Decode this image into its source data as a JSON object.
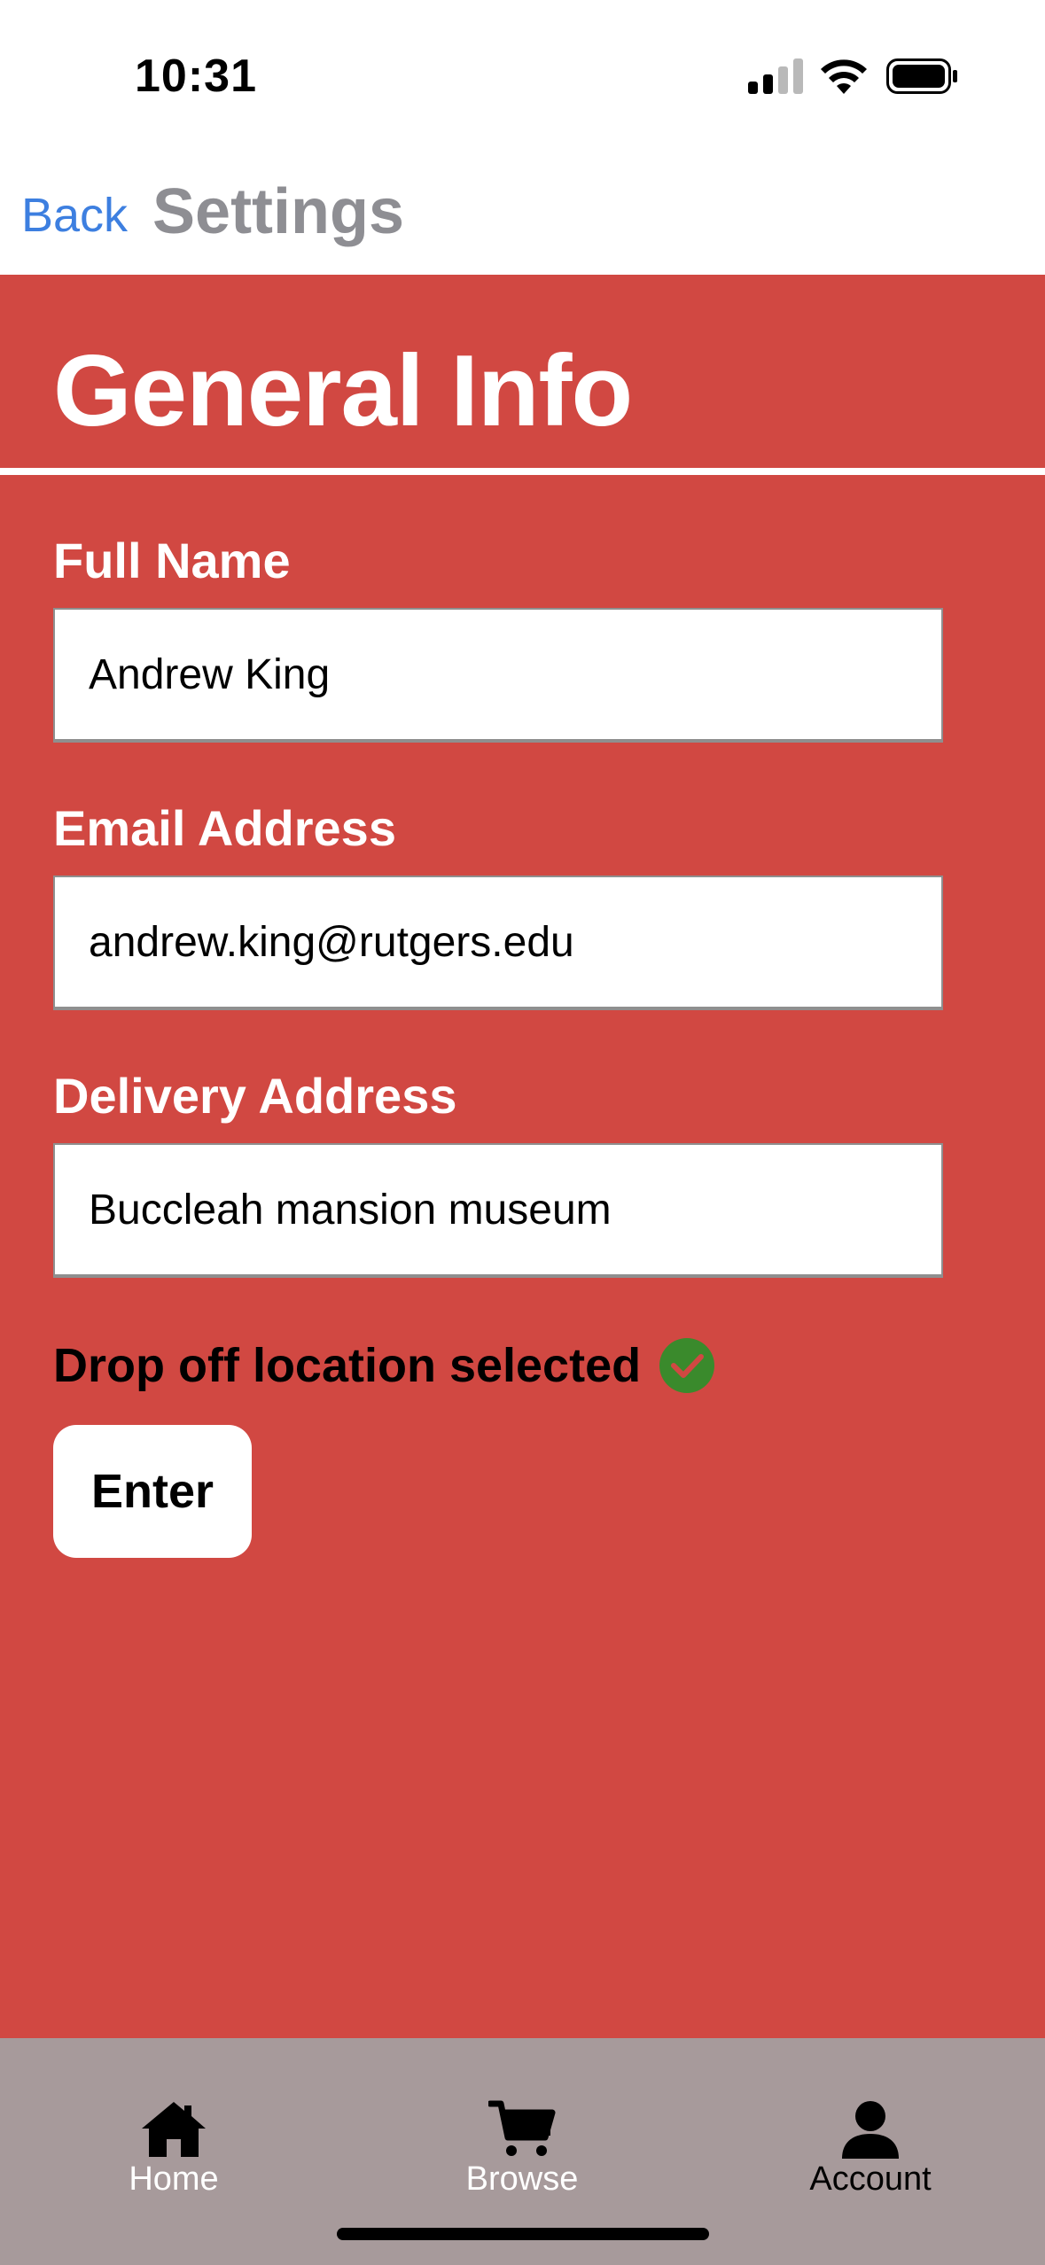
{
  "status_bar": {
    "time": "10:31"
  },
  "nav": {
    "back_label": "Back",
    "title": "Settings"
  },
  "page": {
    "title": "General Info"
  },
  "form": {
    "full_name": {
      "label": "Full Name",
      "value": "Andrew King"
    },
    "email": {
      "label": "Email Address",
      "value": "andrew.king@rutgers.edu"
    },
    "delivery": {
      "label": "Delivery Address",
      "value": "Buccleah mansion museum"
    },
    "status_text": "Drop off location selected",
    "enter_label": "Enter"
  },
  "tabs": [
    {
      "label": "Home",
      "icon": "home-icon"
    },
    {
      "label": "Browse",
      "icon": "cart-icon"
    },
    {
      "label": "Account",
      "icon": "person-icon"
    }
  ],
  "colors": {
    "main_bg": "#d14842",
    "tab_bar_bg": "#a79a9b",
    "link_blue": "#3d7fe0",
    "check_green": "#3a8a2c"
  }
}
